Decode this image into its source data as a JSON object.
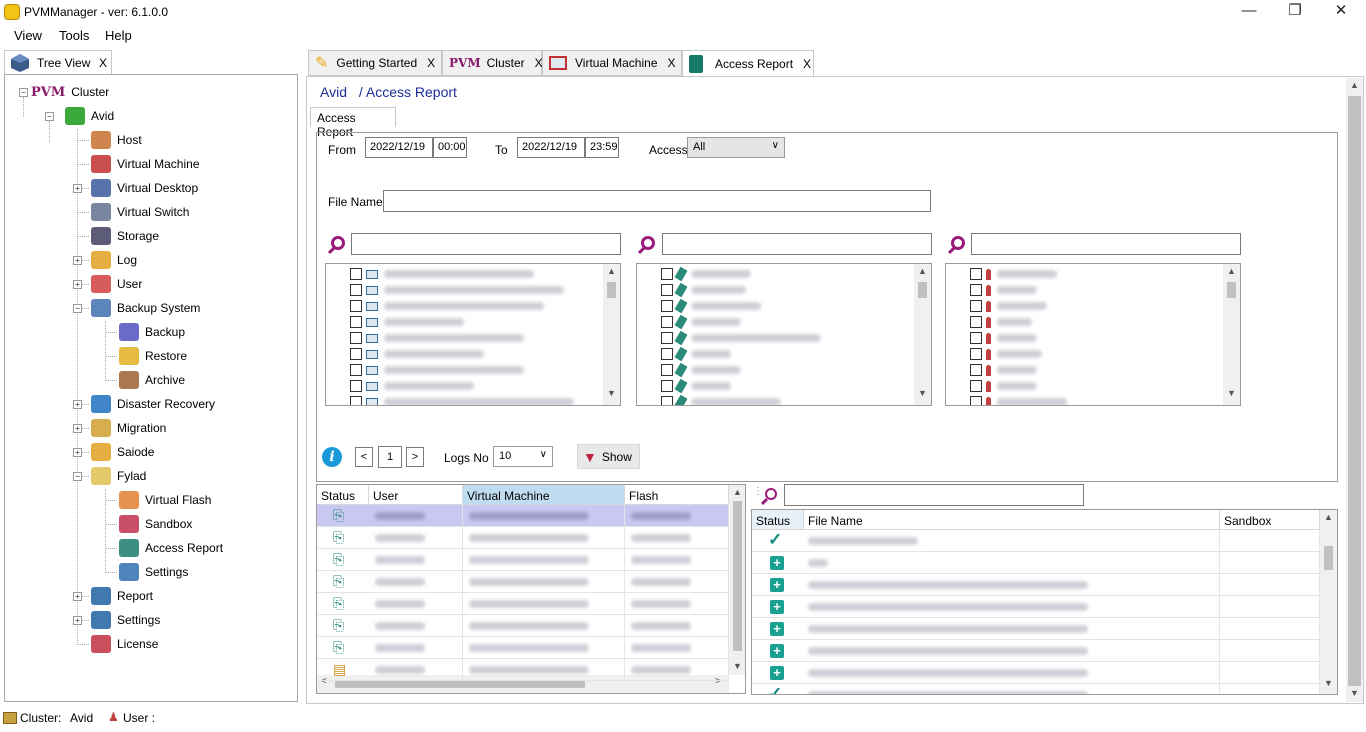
{
  "app": {
    "title": "PVMManager - ver: 6.1.0.0",
    "window_buttons": {
      "minimize": "—",
      "maximize": "❐",
      "close": "✕"
    }
  },
  "menu": {
    "items": [
      "View",
      "Tools",
      "Help"
    ]
  },
  "tree_tab": {
    "label": "Tree View",
    "close": "X"
  },
  "tree": {
    "root": "Cluster",
    "root_prefix": "PVM",
    "node": "Avid",
    "items": [
      {
        "label": "Host",
        "icon": "host-icon"
      },
      {
        "label": "Virtual Machine",
        "icon": "monitor-icon"
      },
      {
        "label": "Virtual Desktop",
        "icon": "desktop-icon"
      },
      {
        "label": "Virtual Switch",
        "icon": "switch-icon"
      },
      {
        "label": "Storage",
        "icon": "storage-icon"
      },
      {
        "label": "Log",
        "icon": "log-icon"
      },
      {
        "label": "User",
        "icon": "user-gear-icon"
      },
      {
        "label": "Backup System",
        "icon": "backup-system-icon"
      },
      {
        "label": "Backup",
        "icon": "backup-icon"
      },
      {
        "label": "Restore",
        "icon": "restore-icon"
      },
      {
        "label": "Archive",
        "icon": "archive-icon"
      },
      {
        "label": "Disaster Recovery",
        "icon": "disaster-recovery-icon"
      },
      {
        "label": "Migration",
        "icon": "migration-icon"
      },
      {
        "label": "Saiode",
        "icon": "cloud-icon"
      },
      {
        "label": "Fylad",
        "icon": "folder-icon"
      },
      {
        "label": "Virtual Flash",
        "icon": "usb-flash-icon"
      },
      {
        "label": "Sandbox",
        "icon": "sandbox-icon"
      },
      {
        "label": "Access Report",
        "icon": "report-book-icon"
      },
      {
        "label": "Settings",
        "icon": "settings-icon"
      },
      {
        "label": "Report",
        "icon": "megaphone-icon"
      },
      {
        "label": "Settings",
        "icon": "gear-icon"
      },
      {
        "label": "License",
        "icon": "license-icon"
      }
    ]
  },
  "tabs": [
    {
      "label": "Getting Started",
      "close": "X"
    },
    {
      "label": "Cluster",
      "prefix": "PVM",
      "close": "X"
    },
    {
      "label": "Virtual Machine",
      "close": "X"
    },
    {
      "label": "Access Report",
      "close": "X"
    }
  ],
  "breadcrumb": {
    "root": "Avid",
    "current": "/ Access Report"
  },
  "subtab": "Access Report",
  "filters": {
    "from_label": "From",
    "from_date": "2022/12/19",
    "from_time": "00:00",
    "to_label": "To",
    "to_date": "2022/12/19",
    "to_time": "23:59",
    "access_label": "Access",
    "access_value": "All",
    "filename_label": "File Name",
    "filename_value": ""
  },
  "pager": {
    "prev": "<",
    "page": "1",
    "next": ">",
    "logs_label": "Logs No",
    "logs_value": "10",
    "show_label": "Show"
  },
  "left_grid": {
    "columns": [
      "Status",
      "User",
      "Virtual Machine",
      "Flash"
    ]
  },
  "right_grid": {
    "columns": [
      "Status",
      "File Name",
      "Sandbox"
    ],
    "statuses": [
      "check",
      "plus",
      "plus",
      "plus",
      "plus",
      "plus",
      "plus",
      "check"
    ]
  },
  "statusbar": {
    "cluster_label": "Cluster:",
    "cluster_value": "Avid",
    "user_label": "User :"
  },
  "colors": {
    "accent": "#1a2e9a",
    "selected_row": "#c8c8f0",
    "header_highlight": "#bfdcf0",
    "teal": "#1aa090"
  }
}
